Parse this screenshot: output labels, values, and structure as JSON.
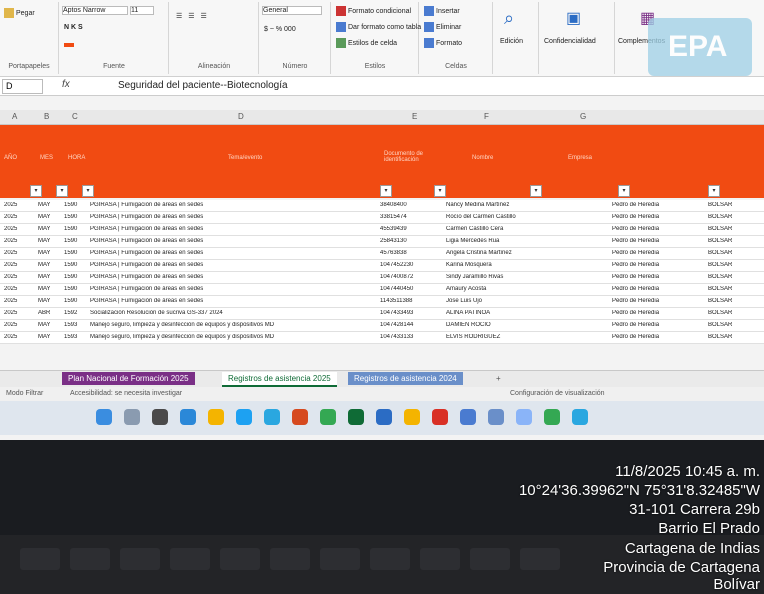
{
  "ribbon": {
    "paste_label": "Pegar",
    "clipboard_label": "Portapapeles",
    "font_name": "Aptos Narrow",
    "font_size": "11",
    "font_label": "Fuente",
    "align_label": "Alineación",
    "number_format": "General",
    "number_label": "Número",
    "styles": [
      "Formato condicional",
      "Dar formato como tabla",
      "Estilos de celda"
    ],
    "styles_label": "Estilos",
    "cells": [
      "Insertar",
      "Eliminar",
      "Formato"
    ],
    "cells_label": "Celdas",
    "edit_label": "Edición",
    "confidential_label": "Confidencialidad",
    "complements_label": "Complementos"
  },
  "formula_bar": {
    "name_box": "D",
    "fx": "fx",
    "content": "Seguridad del paciente--Biotecnología"
  },
  "columns": [
    "A",
    "B",
    "C",
    "D",
    "E",
    "F",
    "G"
  ],
  "header": [
    "AÑO",
    "MES",
    "HORA",
    "Tema/evento",
    "Documento de identificación",
    "Nombre",
    "Empresa"
  ],
  "rows": [
    {
      "year": "2025",
      "month": "MAY",
      "code": "1590",
      "topic": "PGIRASA | Fumigación de áreas en sedes",
      "id": "38408400",
      "name": "Nancy Medina Martínez",
      "org": "Pedro de Heredia",
      "status": "BOLSAR"
    },
    {
      "year": "2025",
      "month": "MAY",
      "code": "1590",
      "topic": "PGIRASA | Fumigación de áreas en sedes",
      "id": "33815474",
      "name": "Rocío del Carmen Castillo",
      "org": "Pedro de Heredia",
      "status": "BOLSAR"
    },
    {
      "year": "2025",
      "month": "MAY",
      "code": "1590",
      "topic": "PGIRASA | Fumigación de áreas en sedes",
      "id": "45539439",
      "name": "Carmen Castillo Cera",
      "org": "Pedro de Heredia",
      "status": "BOLSAR"
    },
    {
      "year": "2025",
      "month": "MAY",
      "code": "1590",
      "topic": "PGIRASA | Fumigación de áreas en sedes",
      "id": "25843130",
      "name": "Ligia Mercedes Rua",
      "org": "Pedro de Heredia",
      "status": "BOLSAR"
    },
    {
      "year": "2025",
      "month": "MAY",
      "code": "1590",
      "topic": "PGIRASA | Fumigación de áreas en sedes",
      "id": "45763838",
      "name": "Ángela Cristina Martínez",
      "org": "Pedro de Heredia",
      "status": "BOLSAR"
    },
    {
      "year": "2025",
      "month": "MAY",
      "code": "1590",
      "topic": "PGIRASA | Fumigación de áreas en sedes",
      "id": "1047452230",
      "name": "Karina Mosquera",
      "org": "Pedro de Heredia",
      "status": "BOLSAR"
    },
    {
      "year": "2025",
      "month": "MAY",
      "code": "1590",
      "topic": "PGIRASA | Fumigación de áreas en sedes",
      "id": "1047400872",
      "name": "Sindy Jaramillo Rivas",
      "org": "Pedro de Heredia",
      "status": "BOLSAR"
    },
    {
      "year": "2025",
      "month": "MAY",
      "code": "1590",
      "topic": "PGIRASA | Fumigación de áreas en sedes",
      "id": "1047440450",
      "name": "Amaury Acosta",
      "org": "Pedro de Heredia",
      "status": "BOLSAR"
    },
    {
      "year": "2025",
      "month": "MAY",
      "code": "1590",
      "topic": "PGIRASA | Fumigación de áreas en sedes",
      "id": "1143511388",
      "name": "Jose Luis Ujo",
      "org": "Pedro de Heredia",
      "status": "BOLSAR"
    },
    {
      "year": "2025",
      "month": "ABR",
      "code": "1592",
      "topic": "Socialización Resolución de sucriva GS-337 2024",
      "id": "1047433493",
      "name": "ALINA PATIÑOA",
      "org": "Pedro de Heredia",
      "status": "BOLSAR"
    },
    {
      "year": "2025",
      "month": "MAY",
      "code": "1593",
      "topic": "Manejo seguro, limpieza y desinfección de equipos y dispositivos MD",
      "id": "1047428144",
      "name": "DAMIEN ROCIO",
      "org": "Pedro de Heredia",
      "status": "BOLSAR"
    },
    {
      "year": "2025",
      "month": "MAY",
      "code": "1593",
      "topic": "Manejo seguro, limpieza y desinfección de equipos y dispositivos MD",
      "id": "1047433133",
      "name": "ELVIS RODRIGUEZ",
      "org": "Pedro de Heredia",
      "status": "BOLSAR"
    }
  ],
  "tabs": [
    "Plan Nacional de Formación 2025",
    "Registros de asistencia 2025",
    "Registros de asistencia 2024"
  ],
  "status": {
    "mode": "Modo Filtrar",
    "accessibility": "Accesibilidad: se necesita investigar",
    "settings": "Configuración de visualización"
  },
  "watermark": "EPA",
  "stamp": {
    "datetime": "11/8/2025 10:45 a. m.",
    "coords": "10°24'36.39962\"N 75°31'8.32485\"W",
    "address": "31-101 Carrera 29b",
    "neighborhood": "Barrio El Prado",
    "city": "Cartagena de Indias",
    "province": "Provincia de Cartagena",
    "state": "Bolívar"
  },
  "colors": {
    "header": "#f14b12",
    "tab_purple": "#7a2f86",
    "tab_green": "#0f6b36",
    "tab_blue": "#6a8fc9"
  }
}
